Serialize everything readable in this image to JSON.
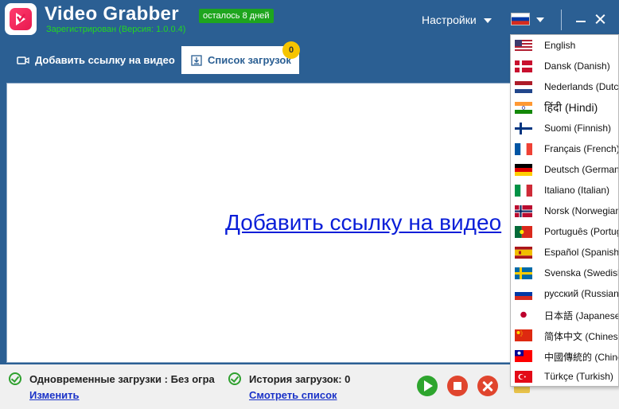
{
  "app": {
    "title": "Video Grabber",
    "trial_badge": "осталось 8 дней",
    "registration": "Зарегистрирован (Версия: 1.0.0.4)"
  },
  "header": {
    "settings_label": "Настройки",
    "current_language_flag": "russia-flag"
  },
  "tabs": [
    {
      "label": "Добавить ссылку на видео",
      "icon": "video-camera-icon",
      "active": false
    },
    {
      "label": "Список загрузок",
      "icon": "download-list-icon",
      "active": true,
      "count": "0"
    }
  ],
  "main": {
    "add_link_text": "Добавить ссылку на видео"
  },
  "status": {
    "concurrent_label": "Одновременные загрузки : Без огра",
    "concurrent_link": "Изменить",
    "history_label": "История загрузок: 0",
    "history_link": "Смотреть список"
  },
  "colors": {
    "header_bg": "#2b5f93",
    "trial_badge_bg": "#1ea51e",
    "registration_text": "#22d622",
    "link_blue": "#0a1ed8",
    "play_green": "#2ea52e",
    "stop_red": "#e0452e",
    "badge_yellow": "#f5c400"
  },
  "languages": [
    {
      "label": "English",
      "flag": "us-flag"
    },
    {
      "label": "Dansk (Danish)",
      "flag": "denmark-flag"
    },
    {
      "label": "Nederlands (Dutch)",
      "flag": "netherlands-flag"
    },
    {
      "label": "हिंदी (Hindi)",
      "flag": "india-flag"
    },
    {
      "label": "Suomi (Finnish)",
      "flag": "finland-flag"
    },
    {
      "label": "Français (French)",
      "flag": "france-flag"
    },
    {
      "label": "Deutsch (German)",
      "flag": "germany-flag"
    },
    {
      "label": "Italiano (Italian)",
      "flag": "italy-flag"
    },
    {
      "label": "Norsk (Norwegian)",
      "flag": "norway-flag"
    },
    {
      "label": "Português (Portuguese)",
      "flag": "portugal-flag"
    },
    {
      "label": "Español (Spanish)",
      "flag": "spain-flag"
    },
    {
      "label": "Svenska (Swedish)",
      "flag": "sweden-flag"
    },
    {
      "label": "русский (Russian)",
      "flag": "russia-flag"
    },
    {
      "label": "日本語 (Japanese)",
      "flag": "japan-flag"
    },
    {
      "label": "简体中文 (Chinese)",
      "flag": "china-flag"
    },
    {
      "label": "中國傳統的 (Chinese)",
      "flag": "taiwan-flag"
    },
    {
      "label": "Türkçe (Turkish)",
      "flag": "turkey-flag"
    }
  ]
}
